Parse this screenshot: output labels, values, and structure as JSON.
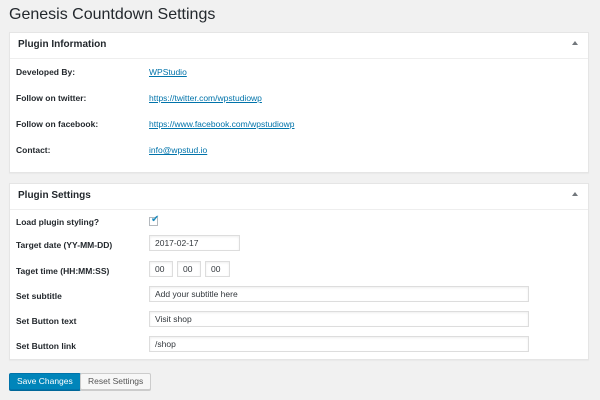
{
  "page": {
    "title": "Genesis Countdown Settings"
  },
  "plugin_info": {
    "title": "Plugin Information",
    "rows": [
      {
        "label": "Developed By:",
        "value": "WPStudio"
      },
      {
        "label": "Follow on twitter:",
        "value": "https://twitter.com/wpstudiowp"
      },
      {
        "label": "Follow on facebook:",
        "value": "https://www.facebook.com/wpstudiowp"
      },
      {
        "label": "Contact:",
        "value": "info@wpstud.io"
      }
    ]
  },
  "plugin_settings": {
    "title": "Plugin Settings",
    "load_styling": {
      "label": "Load plugin styling?",
      "checked": true,
      "check_glyph": "✔"
    },
    "target_date": {
      "label": "Target date (YY-MM-DD)",
      "value": "2017-02-17"
    },
    "target_time": {
      "label": "Taget time (HH:MM:SS)",
      "hours": "00",
      "minutes": "00",
      "seconds": "00"
    },
    "subtitle": {
      "label": "Set subtitle",
      "value": "Add your subtitle here"
    },
    "button_text": {
      "label": "Set Button text",
      "value": "Visit shop"
    },
    "button_link": {
      "label": "Set Button link",
      "value": "/shop"
    }
  },
  "actions": {
    "save_label": "Save Changes",
    "reset_label": "Reset Settings"
  },
  "colors": {
    "primary": "#0085ba",
    "link": "#0073aa",
    "background": "#f1f1f1"
  },
  "icons": {
    "toggle": "triangle-up-icon",
    "checkbox": "checkmark-icon"
  }
}
